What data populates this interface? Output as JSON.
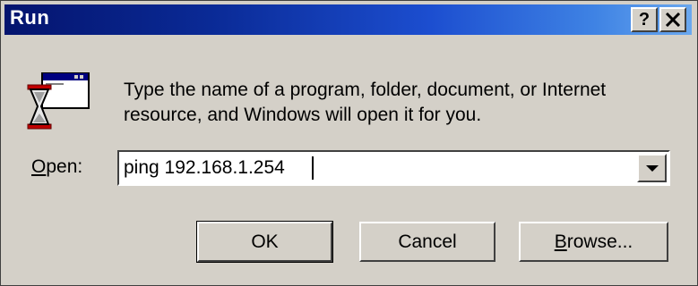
{
  "dialog": {
    "title": "Run",
    "help_button": "?",
    "close_button": "✕",
    "icon": "run-hourglass-window-icon",
    "description": "Type the name of a program, folder, document, or Internet resource, and Windows will open it for you.",
    "open_label_accel": "O",
    "open_label_rest": "pen:",
    "open_value": "ping 192.168.1.254",
    "ok_label": "OK",
    "cancel_label": "Cancel",
    "browse_accel": "B",
    "browse_rest": "rowse..."
  }
}
